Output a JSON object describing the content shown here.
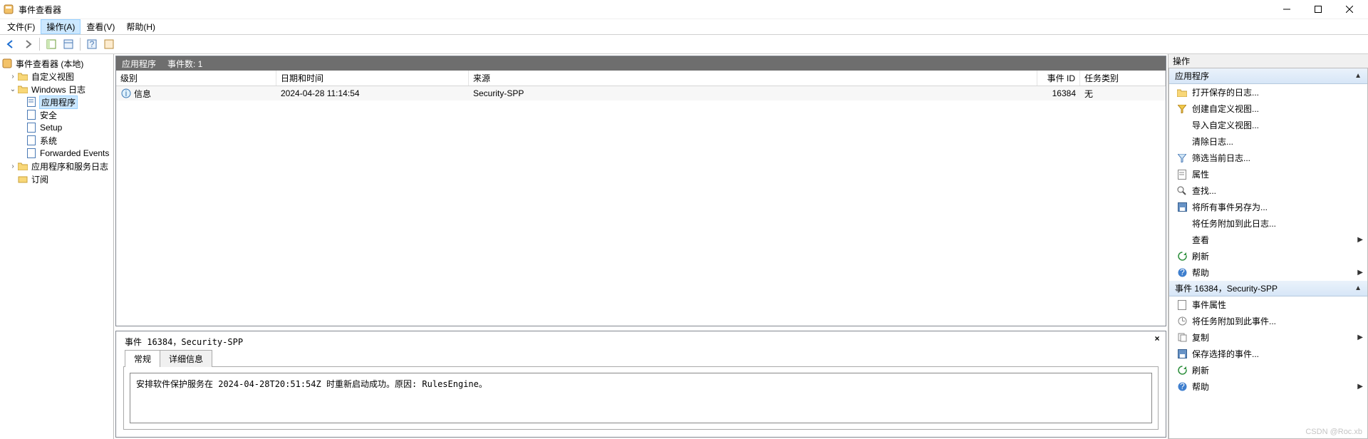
{
  "window": {
    "title": "事件查看器",
    "watermark": "CSDN @Roc.xb"
  },
  "menu": {
    "file": "文件(F)",
    "action": "操作(A)",
    "view": "查看(V)",
    "help": "帮助(H)"
  },
  "tree": {
    "root": "事件查看器 (本地)",
    "custom_views": "自定义视图",
    "windows_logs": "Windows 日志",
    "application": "应用程序",
    "security": "安全",
    "setup": "Setup",
    "system": "系统",
    "forwarded": "Forwarded Events",
    "app_svc_logs": "应用程序和服务日志",
    "subscriptions": "订阅"
  },
  "list": {
    "title_main": "应用程序",
    "title_count": "事件数: 1",
    "columns": {
      "level": "级别",
      "datetime": "日期和时间",
      "source": "来源",
      "event_id": "事件 ID",
      "category": "任务类别"
    },
    "rows": [
      {
        "level": "信息",
        "datetime": "2024-04-28 11:14:54",
        "source": "Security-SPP",
        "event_id": "16384",
        "category": "无"
      }
    ]
  },
  "detail": {
    "title": "事件 16384，Security-SPP",
    "tab_general": "常规",
    "tab_details": "详细信息",
    "body": "安排软件保护服务在 2024-04-28T20:51:54Z 时重新启动成功。原因: RulesEngine。"
  },
  "actions": {
    "panel_title": "操作",
    "section1": "应用程序",
    "open_saved": "打开保存的日志...",
    "create_custom": "创建自定义视图...",
    "import_custom": "导入自定义视图...",
    "clear_log": "清除日志...",
    "filter_current": "筛选当前日志...",
    "properties": "属性",
    "find": "查找...",
    "save_all": "将所有事件另存为...",
    "attach_task_log": "将任务附加到此日志...",
    "view": "查看",
    "refresh": "刷新",
    "help": "帮助",
    "section2": "事件 16384，Security-SPP",
    "event_props": "事件属性",
    "attach_task_event": "将任务附加到此事件...",
    "copy": "复制",
    "save_selected": "保存选择的事件...",
    "refresh2": "刷新",
    "help2": "帮助"
  }
}
